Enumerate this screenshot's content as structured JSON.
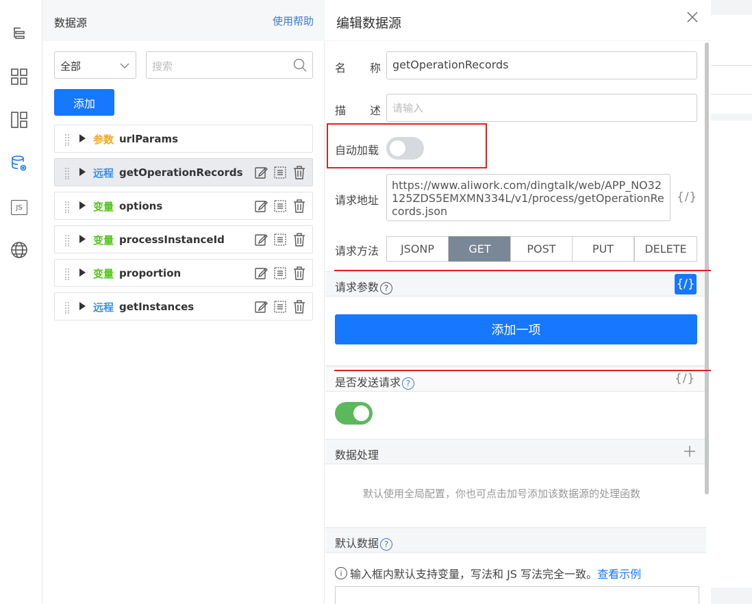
{
  "rail": {
    "icons": [
      "outline-icon",
      "components-icon",
      "layout-icon",
      "datasource-icon",
      "js-icon",
      "globe-icon"
    ],
    "js_label": "JS",
    "active_color": "#1677ff"
  },
  "ds_panel": {
    "title": "数据源",
    "help": "使用帮助",
    "filter_value": "全部",
    "search_placeholder": "搜索",
    "add_label": "添加",
    "items": [
      {
        "type": "参数",
        "name": "urlParams",
        "color": "#f5a623",
        "actions": false
      },
      {
        "type": "远程",
        "name": "getOperationRecords",
        "color": "#3a8ee6",
        "actions": true
      },
      {
        "type": "变量",
        "name": "options",
        "color": "#52c41a",
        "actions": true
      },
      {
        "type": "变量",
        "name": "processInstanceId",
        "color": "#52c41a",
        "actions": true
      },
      {
        "type": "变量",
        "name": "proportion",
        "color": "#52c41a",
        "actions": true
      },
      {
        "type": "远程",
        "name": "getInstances",
        "color": "#3a8ee6",
        "actions": true
      }
    ]
  },
  "edit": {
    "title": "编辑数据源",
    "name_label_1": "名",
    "name_label_2": "称",
    "name_value": "getOperationRecords",
    "desc_label_1": "描",
    "desc_label_2": "述",
    "desc_placeholder": "请输入",
    "autoload_label": "自动加载",
    "autoload_on": false,
    "url_label": "请求地址",
    "url_value": "https://www.aliwork.com/dingtalk/web/APP_NO32125ZDS5EMXMN334L/v1/process/getOperationRecords.json",
    "fx": "{/}",
    "method_label": "请求方法",
    "methods": [
      "JSONP",
      "GET",
      "POST",
      "PUT",
      "DELETE"
    ],
    "method_selected": "GET",
    "params_label": "请求参数",
    "add_item": "添加一项",
    "send_label": "是否发送请求",
    "send_on": true,
    "process_label": "数据处理",
    "process_hint": "默认使用全局配置，你也可点击加号添加该数据源的处理函数",
    "default_label": "默认数据",
    "info_text": "输入框内默认支持变量，写法和 JS 写法完全一致。",
    "info_link": "查看示例"
  },
  "colors": {
    "primary": "#1677ff",
    "toggle_on": "#5cb85c",
    "toggle_off": "#d6d9de",
    "highlight": "#e02020"
  }
}
